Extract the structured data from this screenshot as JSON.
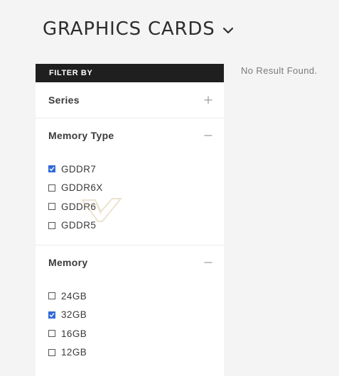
{
  "header": {
    "title": "GRAPHICS CARDS",
    "dropdown_icon": "chevron-down-icon"
  },
  "sidebar": {
    "filter_label": "FILTER BY",
    "groups": [
      {
        "title": "Series",
        "expanded": false,
        "toggle_icon": "plus-icon",
        "options": []
      },
      {
        "title": "Memory Type",
        "expanded": true,
        "toggle_icon": "minus-icon",
        "options": [
          {
            "label": "GDDR7",
            "checked": true
          },
          {
            "label": "GDDR6X",
            "checked": false
          },
          {
            "label": "GDDR6",
            "checked": false
          },
          {
            "label": "GDDR5",
            "checked": false
          }
        ]
      },
      {
        "title": "Memory",
        "expanded": true,
        "toggle_icon": "minus-icon",
        "options": [
          {
            "label": "24GB",
            "checked": false
          },
          {
            "label": "32GB",
            "checked": true
          },
          {
            "label": "16GB",
            "checked": false
          },
          {
            "label": "12GB",
            "checked": false
          }
        ]
      }
    ]
  },
  "main": {
    "empty_message": "No Result Found."
  },
  "colors": {
    "checkbox_checked": "#2f6ad8",
    "filter_bar_bg": "#1f1f1f",
    "page_bg": "#f4f4f4"
  }
}
